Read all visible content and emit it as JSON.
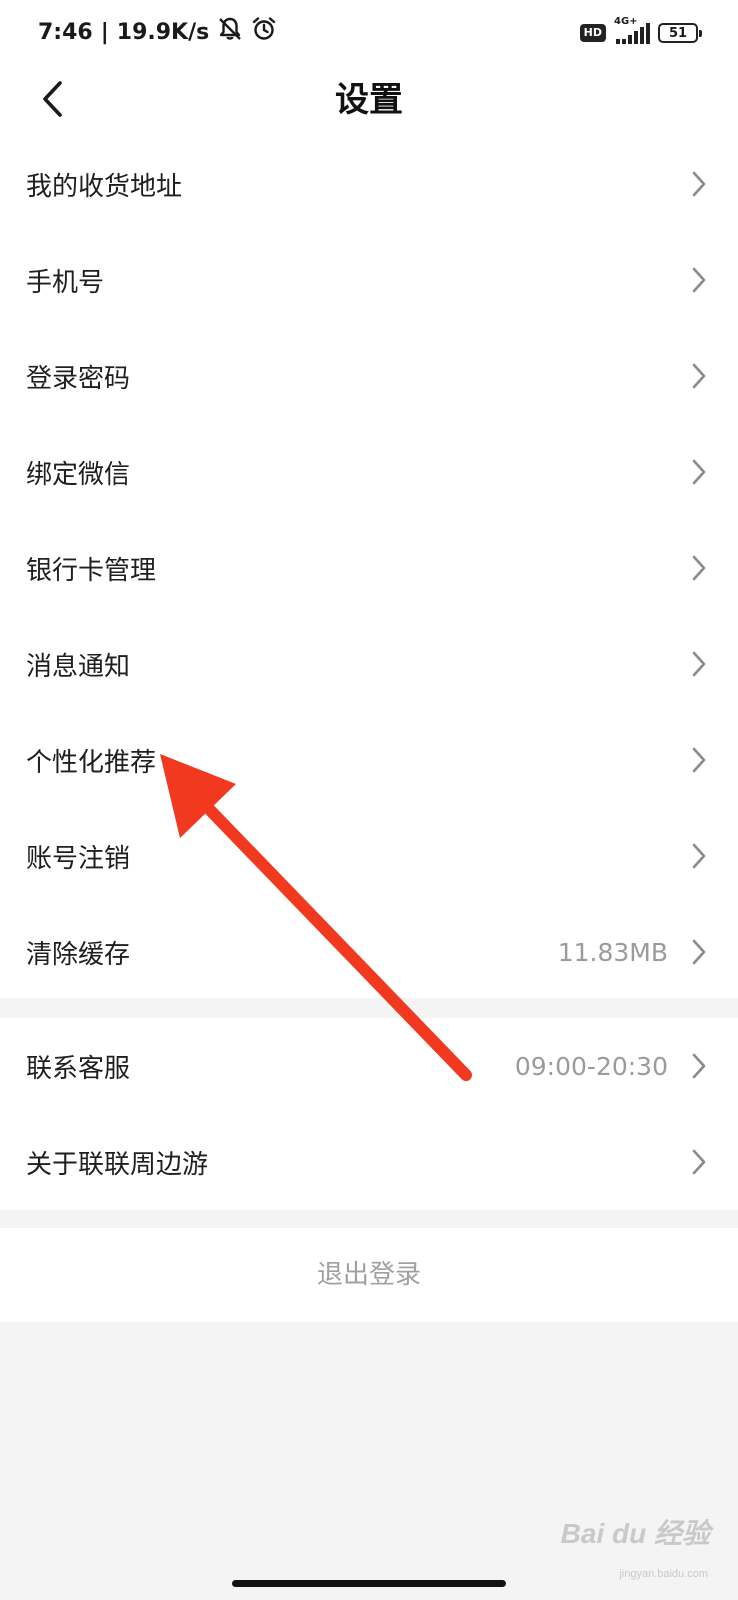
{
  "status_bar": {
    "time": "7:46",
    "separator": "|",
    "speed": "19.9K/s",
    "hd_badge": "HD",
    "network": "4G+",
    "battery": "51",
    "icons": [
      "bell-muted-icon",
      "alarm-icon",
      "signal-icon",
      "battery-icon"
    ]
  },
  "header": {
    "title": "设置",
    "back_icon": "chevron-left-icon"
  },
  "section1": {
    "items": [
      {
        "label": "我的收货地址",
        "value": ""
      },
      {
        "label": "手机号",
        "value": ""
      },
      {
        "label": "登录密码",
        "value": ""
      },
      {
        "label": "绑定微信",
        "value": ""
      },
      {
        "label": "银行卡管理",
        "value": ""
      },
      {
        "label": "消息通知",
        "value": ""
      },
      {
        "label": "个性化推荐",
        "value": ""
      },
      {
        "label": "账号注销",
        "value": ""
      },
      {
        "label": "清除缓存",
        "value": "11.83MB"
      }
    ]
  },
  "section2": {
    "items": [
      {
        "label": "联系客服",
        "value": "09:00-20:30"
      },
      {
        "label": "关于联联周边游",
        "value": ""
      }
    ]
  },
  "logout": {
    "label": "退出登录"
  },
  "watermark": {
    "text": "Bai du 经验",
    "sub": "jingyan.baidu.com"
  },
  "colors": {
    "annotation_arrow": "#f0391e",
    "background": "#f4f4f4",
    "row_bg": "#ffffff",
    "secondary_text": "#9b9b9b"
  }
}
